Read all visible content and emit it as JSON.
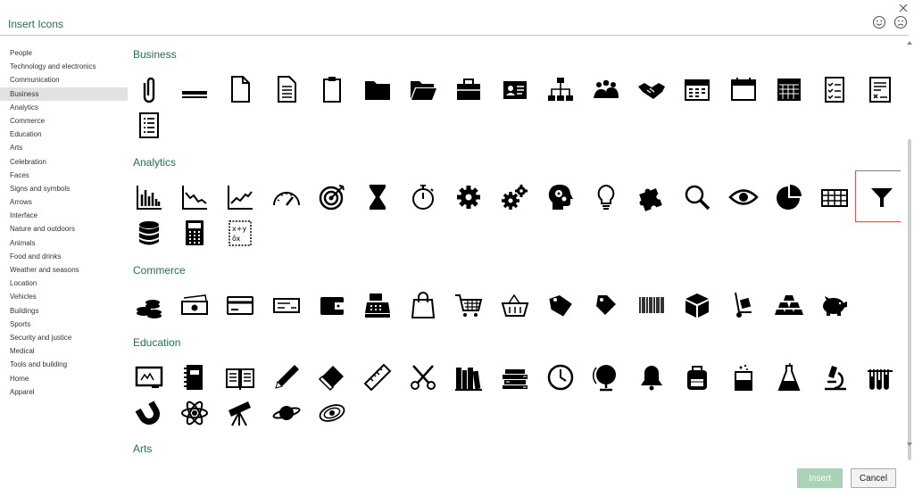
{
  "window": {
    "title": "Insert Icons"
  },
  "sidebar": {
    "selected": "Business",
    "items": [
      "People",
      "Technology and electronics",
      "Communication",
      "Business",
      "Analytics",
      "Commerce",
      "Education",
      "Arts",
      "Celebration",
      "Faces",
      "Signs and symbols",
      "Arrows",
      "Interface",
      "Nature and outdoors",
      "Animals",
      "Food and drinks",
      "Weather and seasons",
      "Location",
      "Vehicles",
      "Buildings",
      "Sports",
      "Security and justice",
      "Medical",
      "Tools and building",
      "Home",
      "Apparel"
    ]
  },
  "sections": [
    {
      "title": "Business",
      "icons": [
        "paperclip-icon",
        "stapler-icon",
        "document-icon",
        "document-lines-icon",
        "clipboard-icon",
        "folder-icon",
        "folder-open-icon",
        "briefcase-icon",
        "id-badge-icon",
        "org-chart-icon",
        "meeting-icon",
        "handshake-icon",
        "calendar-icon",
        "calendar-blank-icon",
        "calendar-grid-icon",
        "checklist-icon",
        "contract-icon",
        "list-document-icon"
      ]
    },
    {
      "title": "Analytics",
      "icons": [
        "bar-chart-icon",
        "line-chart-down-icon",
        "line-chart-up-icon",
        "gauge-icon",
        "target-icon",
        "hourglass-icon",
        "stopwatch-icon",
        "gear-icon",
        "gears-icon",
        "head-gears-icon",
        "lightbulb-icon",
        "puzzle-icon",
        "magnifier-icon",
        "eye-icon",
        "pie-chart-icon",
        "table-icon",
        "funnel-icon",
        "database-icon",
        "calculator-icon",
        "formula-icon"
      ]
    },
    {
      "title": "Commerce",
      "icons": [
        "coins-icon",
        "cash-icon",
        "credit-card-icon",
        "check-icon",
        "wallet-icon",
        "cash-register-icon",
        "shopping-bag-icon",
        "shopping-cart-icon",
        "basket-icon",
        "price-tag-icon",
        "tag-icon",
        "barcode-icon",
        "box-icon",
        "hand-truck-icon",
        "gold-bars-icon",
        "piggy-bank-icon"
      ]
    },
    {
      "title": "Education",
      "icons": [
        "chalkboard-icon",
        "notebook-icon",
        "open-book-icon",
        "pencil-icon",
        "eraser-icon",
        "ruler-icon",
        "scissors-icon",
        "books-icon",
        "book-stack-icon",
        "clock-icon",
        "globe-icon",
        "bell-icon",
        "backpack-icon",
        "beaker-icon",
        "flask-icon",
        "microscope-icon",
        "test-tubes-icon",
        "magnet-icon",
        "atom-icon",
        "telescope-icon",
        "planet-icon",
        "galaxy-icon"
      ]
    },
    {
      "title": "Arts",
      "icons": []
    }
  ],
  "selected_icon": "funnel-icon",
  "buttons": {
    "insert": "Insert",
    "cancel": "Cancel"
  }
}
